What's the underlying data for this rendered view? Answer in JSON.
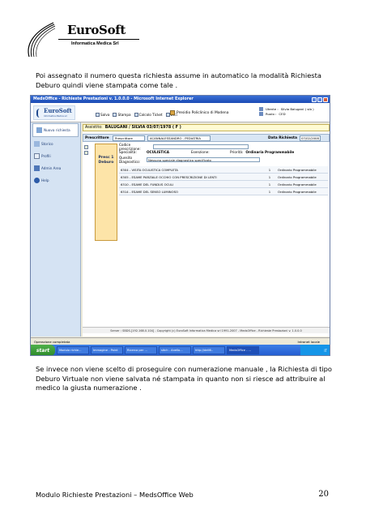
{
  "doc": {
    "logo_brand": "EuroSoft",
    "logo_sub": "Informatica Medica Srl",
    "para1": "Poi assegnato il numero questa richiesta assume in automatico la modalità Richiesta Deburo quindi viene stampata come tale .",
    "para2": "Se invece non viene scelto di proseguire con numerazione manuale , la Richiesta di tipo Deburo Virtuale non viene salvata né stampata in quanto non si riesce ad attribuire al medico la giusta numerazione .",
    "footer_left": "Modulo Richieste Prestazioni – MedsOffice Web",
    "page_number": "20"
  },
  "shot": {
    "window_title": "MedsOffice - Richieste Prestazioni v. 1.0.0.0 - Microsoft Internet Explorer",
    "logo_text": "EuroSoft",
    "logo_sub": "Informatica Medica srl",
    "toolbar": [
      "Salva",
      "Stampa",
      "Calcolo Ticket",
      "Esci"
    ],
    "hospital": "Presidio Policlinico di Modena",
    "user_label": "Utente :",
    "user_value": "Silvia Balugani ( sib )",
    "ruolo_label": "Ruolo :",
    "ruolo_value": "CED",
    "sidebar": [
      "Nuova richiesta",
      "Storico",
      "Profili",
      "Admin Area",
      "Help"
    ],
    "assistito_label": "Assistito:",
    "assistito_value": "BALUGANI / SILVIA 03/07/1978 ( F )",
    "prescrittore_label": "Prescrittore",
    "prescrittore_sel": "Prescrittore",
    "prescrittore_val": "ACANNALESSANDRO - PEDIATRIA",
    "data_label": "Data Richiesta",
    "data_value": "07/02/2008",
    "card": [
      "Presc 1",
      "Deburo"
    ],
    "codice_label": "Codice prescrizione:",
    "spec_label": "Specialità:",
    "spec_value": "OCULISTICA",
    "esenzione_label": "Esenzione:",
    "priorita_label": "Priorità:",
    "priorita_value": "Ordinaria Programmabile",
    "quesito_label": "Quesito Diagnostico:",
    "quesito_value": "Nessuno speciale diagnostico specificato",
    "rows": [
      {
        "desc": "6304 - VISITA OCULISTICA COMPLETA",
        "qty": "1",
        "prio": "Ordinario Programmabile"
      },
      {
        "desc": "6305 - ESAME PARZIALE OCCHIO CON PRESCRIZIONE DI LENTI",
        "qty": "1",
        "prio": "Ordinario Programmabile"
      },
      {
        "desc": "6310 - ESAME DEL FUNDUS OCULI",
        "qty": "1",
        "prio": "Ordinario Programmabile"
      },
      {
        "desc": "6314 - ESAME DEL SENSO LUMINOSO",
        "qty": "1",
        "prio": "Ordinario Programmabile"
      }
    ],
    "statusline": "Server : SBDS-[192.168.0.104] - Copyright (c) EuroSoft Informatica Medica srl 1991-2007 - MedsOffice - Richieste Prestazioni v. 1.0.0.0",
    "ie_status": "Operazione completata",
    "ie_zone": "Intranet locale",
    "start": "start",
    "tasks": [
      "Modulo richie...",
      "Immagine - Paint",
      "Ricerca per ...",
      "sitch - Anello...",
      "http://dell6..",
      "MedsOffice - ..."
    ],
    "tray": "IT"
  }
}
